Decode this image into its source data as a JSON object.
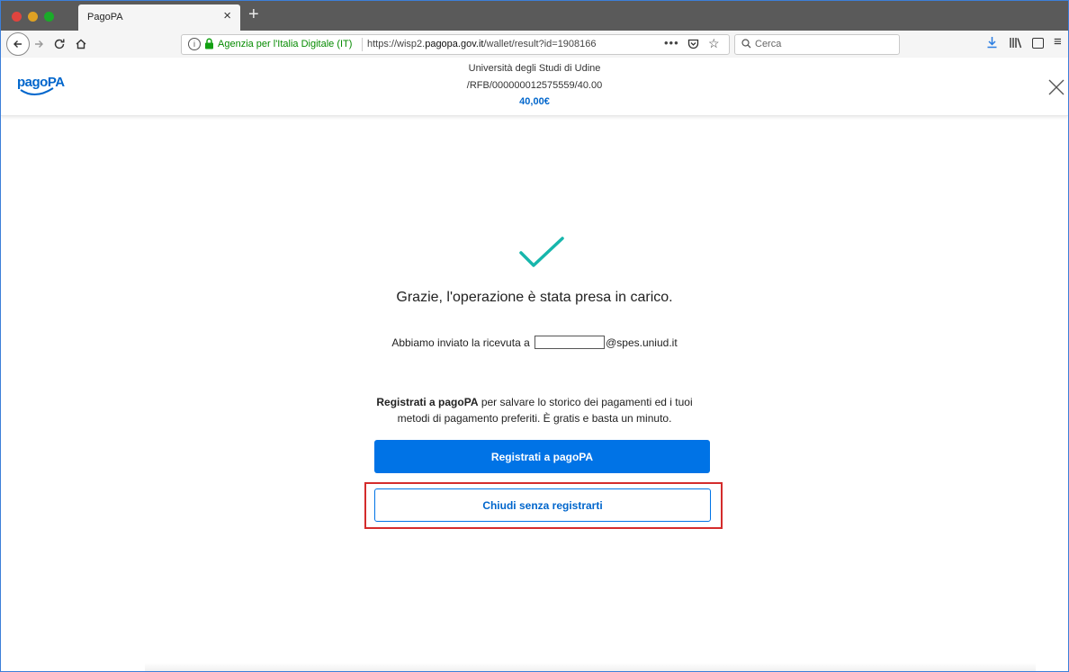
{
  "browser": {
    "tab_title": "PagoPA",
    "tab_close": "×",
    "new_tab": "+",
    "url_org": "Agenzia per l'Italia Digitale (IT)",
    "url_prefix": "https://wisp2.",
    "url_domain": "pagopa.gov.it",
    "url_path": "/wallet/result?id=1908166",
    "url_more": "•••",
    "search_placeholder": "Cerca"
  },
  "header": {
    "logo_text": "pagoPA",
    "creditor": "Università degli Studi di Udine",
    "reference": "/RFB/000000012575559/40.00",
    "amount": "40,00€"
  },
  "main": {
    "title": "Grazie, l'operazione è stata presa in carico.",
    "receipt_prefix": "Abbiamo inviato la ricevuta a",
    "receipt_suffix": "@spes.uniud.it",
    "promo_strong": "Registrati a pagoPA",
    "promo_rest": " per salvare lo storico dei pagamenti ed i tuoi",
    "promo_line2": "metodi di pagamento preferiti. È gratis e basta un minuto.",
    "register_button": "Registrati a pagoPA",
    "close_button": "Chiudi senza registrarti"
  },
  "colors": {
    "primary": "#0073e6",
    "success": "#17b6ac",
    "highlight": "#d42c2c"
  }
}
